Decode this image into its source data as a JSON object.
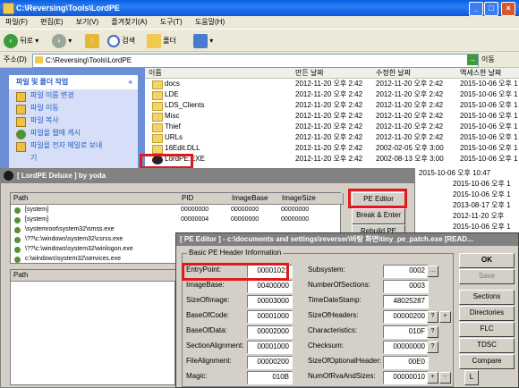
{
  "explorer": {
    "title": "C:\\Reversing\\Tools\\LordPE",
    "menu": [
      "파일(F)",
      "편집(E)",
      "보기(V)",
      "즐겨찾기(A)",
      "도구(T)",
      "도움말(H)"
    ],
    "back_label": "뒤로",
    "search_label": "검색",
    "folders_label": "폴더",
    "address_label": "주소(D)",
    "address_value": "C:\\Reversing\\Tools\\LordPE",
    "go_label": "이동",
    "task_header": "파일 및 폴더 작업",
    "tasks": [
      "파일 이름 변경",
      "파일 이동",
      "파일 복사",
      "파일을 웹에 게시",
      "파일을 전자 메일로 보내",
      "기"
    ],
    "columns": {
      "name": "이름",
      "modified": "만든 날짜",
      "changed": "수정한 날짜",
      "accessed": "액세스한 날짜"
    },
    "rows": [
      {
        "name": "docs",
        "modified": "2012-11-20 오후 2:42",
        "changed": "2012-11-20 오후 2:42",
        "accessed": "2015-10-06 오후 1"
      },
      {
        "name": "LDE",
        "modified": "2012-11-20 오후 2:42",
        "changed": "2012-11-20 오후 2:42",
        "accessed": "2015-10-06 오후 1"
      },
      {
        "name": "LDS_Clients",
        "modified": "2012-11-20 오후 2:42",
        "changed": "2012-11-20 오후 2:42",
        "accessed": "2015-10-06 오후 1"
      },
      {
        "name": "Misc",
        "modified": "2012-11-20 오후 2:42",
        "changed": "2012-11-20 오후 2:42",
        "accessed": "2015-10-06 오후 1"
      },
      {
        "name": "Thief",
        "modified": "2012-11-20 오후 2:42",
        "changed": "2012-11-20 오후 2:42",
        "accessed": "2015-10-06 오후 1"
      },
      {
        "name": "URLs",
        "modified": "2012-11-20 오후 2:42",
        "changed": "2012-11-20 오후 2:42",
        "accessed": "2015-10-06 오후 1"
      },
      {
        "name": "16Edit.DLL",
        "modified": "2012-11-20 오후 2:42",
        "changed": "2002-02-05 오후 3:00",
        "accessed": "2015-10-06 오후 1"
      },
      {
        "name": "LordPE.EXE",
        "modified": "2012-11-20 오후 2:42",
        "changed": "2002-08-13 오후 3:00",
        "accessed": "2015-10-06 오후 1"
      }
    ]
  },
  "lordpe": {
    "title": "[ LordPE Deluxe ] by yoda",
    "columns": {
      "path": "Path",
      "pid": "PID",
      "imagebase": "ImageBase",
      "imagesize": "ImageSize"
    },
    "processes": [
      {
        "path": "[system]",
        "pid": "00000000",
        "imagebase": "00000000",
        "imagesize": "00000000"
      },
      {
        "path": "[system]",
        "pid": "00000004",
        "imagebase": "00000000",
        "imagesize": "00000000"
      },
      {
        "path": "\\systemroot\\system32\\smss.exe",
        "pid": "",
        "imagebase": "",
        "imagesize": ""
      },
      {
        "path": "\\??\\c:\\windows\\system32\\csrss.exe",
        "pid": "",
        "imagebase": "",
        "imagesize": ""
      },
      {
        "path": "\\??\\c:\\windows\\system32\\winlogon.exe",
        "pid": "",
        "imagebase": "",
        "imagesize": ""
      },
      {
        "path": "c:\\windows\\system32\\services.exe",
        "pid": "",
        "imagebase": "",
        "imagesize": ""
      }
    ],
    "modules_column": "Path",
    "buttons": [
      "PE Editor",
      "Break & Enter",
      "Rebuild PE"
    ],
    "side_dates": [
      "2015-10-06 오후 1",
      "2015-10-06 오후 1",
      "2015-10-06 오후 1",
      "2013-08-17 오후 1",
      "2012-11-20 오후",
      "2015-10-06 오후 1"
    ],
    "side_times": [
      "2015-10-06 오후 10:47"
    ]
  },
  "pe_editor": {
    "title": "[ PE Editor ] - c:\\documents and settings\\reverser\\바탕 화면\\tiny_pe_patch.exe [READ...",
    "group_label": "Basic PE Header Information",
    "left_fields": [
      {
        "label": "EntryPoint:",
        "value": "00001021"
      },
      {
        "label": "ImageBase:",
        "value": "00400000"
      },
      {
        "label": "SizeOfImage:",
        "value": "00003000"
      },
      {
        "label": "BaseOfCode:",
        "value": "00001000"
      },
      {
        "label": "BaseOfData:",
        "value": "00002000"
      },
      {
        "label": "SectionAlignment:",
        "value": "00001000"
      },
      {
        "label": "FileAlignment:",
        "value": "00000200"
      },
      {
        "label": "Magic:",
        "value": "010B"
      }
    ],
    "right_fields": [
      {
        "label": "Subsystem:",
        "value": "0002"
      },
      {
        "label": "NumberOfSections:",
        "value": "0003"
      },
      {
        "label": "TimeDateStamp:",
        "value": "48025287"
      },
      {
        "label": "SizeOfHeaders:",
        "value": "00000200"
      },
      {
        "label": "Characteristics:",
        "value": "010F"
      },
      {
        "label": "Checksum:",
        "value": "00000000"
      },
      {
        "label": "SizeOfOptionalHeader:",
        "value": "00E0"
      },
      {
        "label": "NumOfRvaAndSizes:",
        "value": "00000010"
      }
    ],
    "buttons": [
      "OK",
      "Save",
      "Sections",
      "Directories",
      "FLC",
      "TDSC",
      "Compare",
      "L"
    ]
  }
}
